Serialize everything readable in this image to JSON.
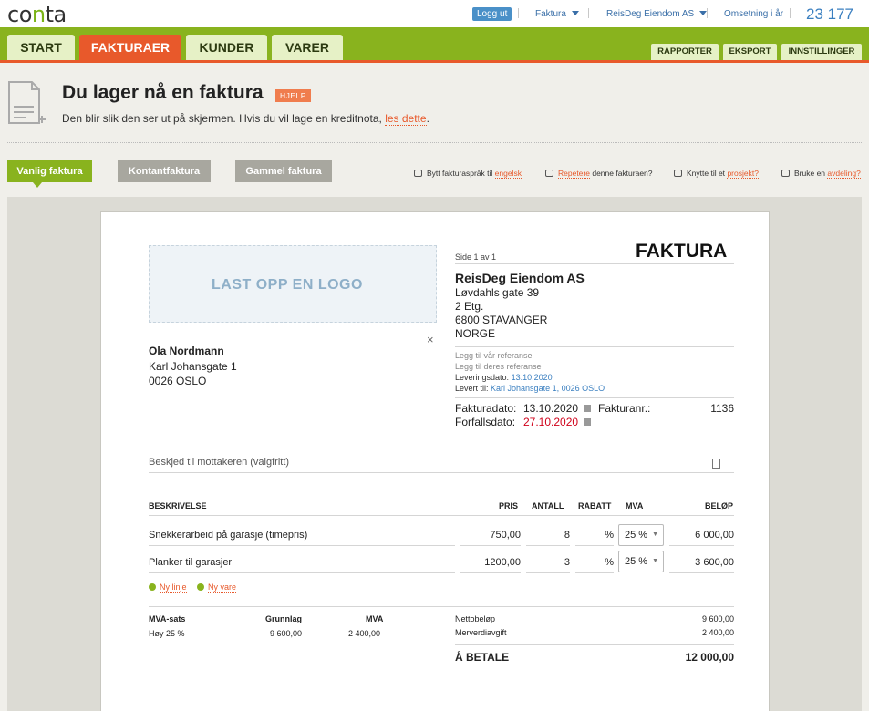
{
  "topbar": {
    "logout": "Logg ut",
    "faktura_menu": "Faktura",
    "company_menu": "ReisDeg Eiendom AS",
    "turnover_label": "Omsetning i år",
    "turnover_value": "23 177"
  },
  "nav": {
    "tabs": [
      "START",
      "FAKTURAER",
      "KUNDER",
      "VARER"
    ],
    "right_tabs": [
      "RAPPORTER",
      "EKSPORT",
      "INNSTILLINGER"
    ]
  },
  "heading": {
    "title": "Du lager nå en faktura",
    "help": "HJELP",
    "subtitle": "Den blir slik den ser ut på skjermen. Hvis du vil lage en kreditnota,",
    "subtitle_link": "les dette",
    "subtitle_end": "."
  },
  "invoice_types": [
    "Vanlig faktura",
    "Kontantfaktura",
    "Gammel faktura"
  ],
  "options": {
    "language_pre": "Bytt fakturaspråk til",
    "language_link": "engelsk",
    "repeat_link": "Repetere",
    "repeat_post": "denne fakturaen?",
    "project_pre": "Knytte til et",
    "project_link": "prosjekt?",
    "department_pre": "Bruke en",
    "department_link": "avdeling?"
  },
  "invoice": {
    "logo_upload": "LAST OPP EN LOGO",
    "page_label": "Side 1 av 1",
    "doc_title": "FAKTURA",
    "customer": {
      "name": "Ola Nordmann",
      "address": "Karl Johansgate 1",
      "postal": "0026 OSLO"
    },
    "company": {
      "name": "ReisDeg Eiendom AS",
      "address1": "Løvdahls gate 39",
      "address2": "2 Etg.",
      "postal": "6800 STAVANGER",
      "country": "NORGE"
    },
    "refs": {
      "our_ref": "Legg til vår referanse",
      "their_ref": "Legg til deres referanse",
      "delivery_date_label": "Leveringsdato:",
      "delivery_date": "13.10.2020",
      "delivered_to_label": "Levert til:",
      "delivered_to": "Karl Johansgate 1, 0026 OSLO"
    },
    "dates": {
      "invoice_date_label": "Fakturadato:",
      "invoice_date": "13.10.2020",
      "invoice_no_label": "Fakturanr.:",
      "invoice_no": "1136",
      "due_date_label": "Forfallsdato:",
      "due_date": "27.10.2020"
    },
    "message_placeholder": "Beskjed til mottakeren (valgfritt)",
    "columns": {
      "desc": "BESKRIVELSE",
      "price": "PRIS",
      "qty": "ANTALL",
      "discount": "RABATT",
      "vat": "MVA",
      "amount": "BELØP"
    },
    "lines": [
      {
        "desc": "Snekkerarbeid på garasje (timepris)",
        "price": "750,00",
        "qty": "8",
        "discount": "%",
        "vat": "25 %",
        "amount": "6 000,00"
      },
      {
        "desc": "Planker til garasjer",
        "price": "1200,00",
        "qty": "3",
        "discount": "%",
        "vat": "25 %",
        "amount": "3 600,00"
      }
    ],
    "add_line": "Ny linje",
    "add_item": "Ny vare",
    "vat_table": {
      "headers": [
        "MVA-sats",
        "Grunnlag",
        "MVA"
      ],
      "row": [
        "Høy 25 %",
        "9 600,00",
        "2 400,00"
      ]
    },
    "totals": {
      "net_label": "Nettobeløp",
      "net": "9 600,00",
      "vat_label": "Merverdiavgift",
      "vat": "2 400,00",
      "pay_label": "Å BETALE",
      "pay": "12 000,00"
    }
  },
  "colors": {
    "brand_green": "#89b31e",
    "accent_orange": "#e8592b",
    "link_blue": "#3a7fc0"
  }
}
